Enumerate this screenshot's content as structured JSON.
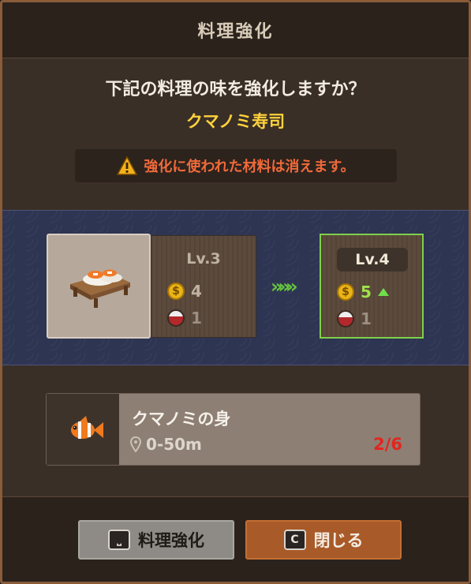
{
  "window": {
    "title": "料理強化"
  },
  "prompt": {
    "question": "下記の料理の味を強化しますか？",
    "dish_name": "クマノミ寿司",
    "warning": "強化に使われた材料は消えます。",
    "warning_icon": "warning-triangle-icon"
  },
  "current": {
    "level": "Lv.3",
    "price": "4",
    "bowl": "1"
  },
  "next": {
    "level": "Lv.4",
    "price": "5",
    "bowl": "1"
  },
  "transition_arrows": "»»»",
  "ingredient": {
    "name": "クマノミの身",
    "range": "0-50m",
    "count": "2/6",
    "icon": "clownfish-icon"
  },
  "buttons": {
    "enhance": {
      "key": "⎵",
      "label": "料理強化"
    },
    "close": {
      "key": "C",
      "label": "閉じる"
    }
  },
  "colors": {
    "accent_yellow": "#ffd23c",
    "warning": "#f06a3a",
    "upgrade_green": "#7fd04a",
    "count_red": "#e3251f",
    "close_button": "#a85a28"
  }
}
